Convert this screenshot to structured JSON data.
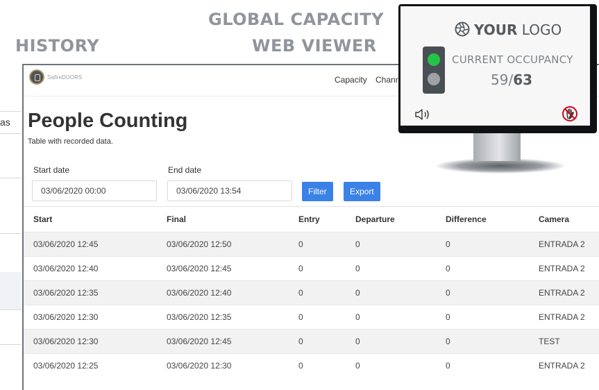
{
  "promo": {
    "history": "HISTORY",
    "global_line1": "GLOBAL CAPACITY",
    "global_line2": "WEB VIEWER"
  },
  "background_window": {
    "partial_text": "as"
  },
  "navbar": {
    "brand": "SafireDOORS",
    "links": [
      "Capacity",
      "Chann"
    ]
  },
  "page": {
    "title": "People Counting",
    "subtitle": "Table with recorded data."
  },
  "filters": {
    "start_label": "Start date",
    "start_value": "03/06/2020 00:00",
    "end_label": "End date",
    "end_value": "03/06/2020 13:54",
    "filter_button": "Filter",
    "export_button": "Export"
  },
  "table": {
    "headers": [
      "Start",
      "Final",
      "Entry",
      "Departure",
      "Difference",
      "Camera"
    ],
    "rows": [
      [
        "03/06/2020 12:45",
        "03/06/2020 12:50",
        "0",
        "0",
        "0",
        "ENTRADA 2"
      ],
      [
        "03/06/2020 12:40",
        "03/06/2020 12:45",
        "0",
        "0",
        "0",
        "ENTRADA 2"
      ],
      [
        "03/06/2020 12:35",
        "03/06/2020 12:40",
        "0",
        "0",
        "0",
        "ENTRADA 2"
      ],
      [
        "03/06/2020 12:30",
        "03/06/2020 12:35",
        "0",
        "0",
        "0",
        "ENTRADA 2"
      ],
      [
        "03/06/2020 12:30",
        "03/06/2020 12:45",
        "0",
        "0",
        "0",
        "TEST"
      ],
      [
        "03/06/2020 12:25",
        "03/06/2020 12:30",
        "0",
        "0",
        "0",
        "ENTRADA 2"
      ]
    ]
  },
  "monitor": {
    "logo_bold": "YOUR",
    "logo_light": "LOGO",
    "occupancy_label": "CURRENT OCCUPANCY",
    "occupancy_current": "59",
    "occupancy_separator": "/",
    "occupancy_max": "63",
    "traffic_light": {
      "active": "green"
    },
    "icons": [
      "aperture-icon",
      "speaker-icon",
      "no-hand-icon"
    ]
  },
  "colors": {
    "accent_button": "#3b82e6",
    "promo_text": "#8f959b",
    "light_green": "#23c447"
  }
}
